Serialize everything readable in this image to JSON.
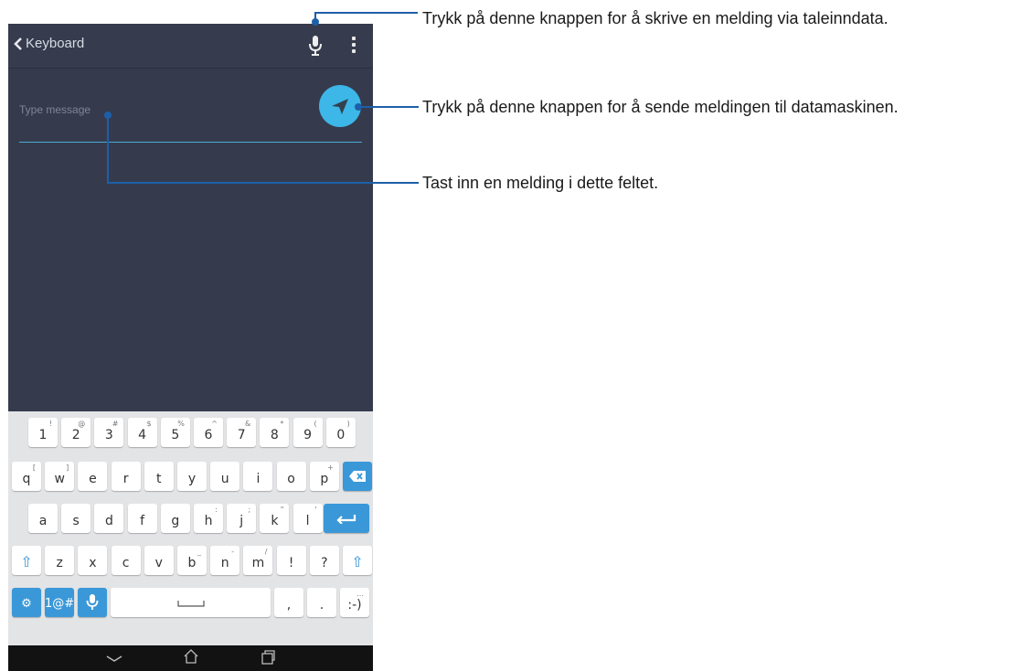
{
  "header": {
    "back_label": "Keyboard"
  },
  "composer": {
    "placeholder": "Type message"
  },
  "keyboard": {
    "row1": [
      {
        "label": "1",
        "sub": "!"
      },
      {
        "label": "2",
        "sub": "@"
      },
      {
        "label": "3",
        "sub": "#"
      },
      {
        "label": "4",
        "sub": "$"
      },
      {
        "label": "5",
        "sub": "%"
      },
      {
        "label": "6",
        "sub": "^"
      },
      {
        "label": "7",
        "sub": "&"
      },
      {
        "label": "8",
        "sub": "*"
      },
      {
        "label": "9",
        "sub": "("
      },
      {
        "label": "0",
        "sub": ")"
      }
    ],
    "row2": [
      {
        "label": "q",
        "sub": "["
      },
      {
        "label": "w",
        "sub": "]"
      },
      {
        "label": "e",
        "sub": ""
      },
      {
        "label": "r",
        "sub": ""
      },
      {
        "label": "t",
        "sub": ""
      },
      {
        "label": "y",
        "sub": ""
      },
      {
        "label": "u",
        "sub": ""
      },
      {
        "label": "i",
        "sub": ""
      },
      {
        "label": "o",
        "sub": ""
      },
      {
        "label": "p",
        "sub": "+"
      }
    ],
    "row3": [
      {
        "label": "a",
        "sub": ""
      },
      {
        "label": "s",
        "sub": ""
      },
      {
        "label": "d",
        "sub": ""
      },
      {
        "label": "f",
        "sub": ""
      },
      {
        "label": "g",
        "sub": ""
      },
      {
        "label": "h",
        "sub": ":"
      },
      {
        "label": "j",
        "sub": ";"
      },
      {
        "label": "k",
        "sub": "\""
      },
      {
        "label": "l",
        "sub": "'"
      }
    ],
    "row4": [
      {
        "label": "z",
        "sub": ""
      },
      {
        "label": "x",
        "sub": ""
      },
      {
        "label": "c",
        "sub": ""
      },
      {
        "label": "v",
        "sub": ""
      },
      {
        "label": "b",
        "sub": "_"
      },
      {
        "label": "n",
        "sub": "-"
      },
      {
        "label": "m",
        "sub": "/"
      },
      {
        "label": "!",
        "sub": ""
      },
      {
        "label": "?",
        "sub": ""
      }
    ],
    "symbols_label": "1@#",
    "comma_label": ",",
    "period_label": ".",
    "emoji_label": ":-)",
    "emoji_sub": "…",
    "shift_glyph": "⇧",
    "settings_glyph": "⚙"
  },
  "callouts": {
    "mic": "Trykk på denne knappen for å skrive en melding via taleinndata.",
    "send": "Trykk på denne knappen for å sende meldingen til datamaskinen.",
    "field": "Tast inn en melding i dette feltet."
  },
  "colors": {
    "screen_bg": "#353b4d",
    "accent": "#3db6e8",
    "key_blue": "#3a98d8",
    "callout_line": "#1d5fa8"
  },
  "icons": [
    "chevron-left-icon",
    "microphone-icon",
    "kebab-menu-icon",
    "send-icon",
    "backspace-icon",
    "enter-icon",
    "shift-icon",
    "gear-icon",
    "space-icon",
    "back-nav-icon",
    "home-icon",
    "recents-icon"
  ]
}
